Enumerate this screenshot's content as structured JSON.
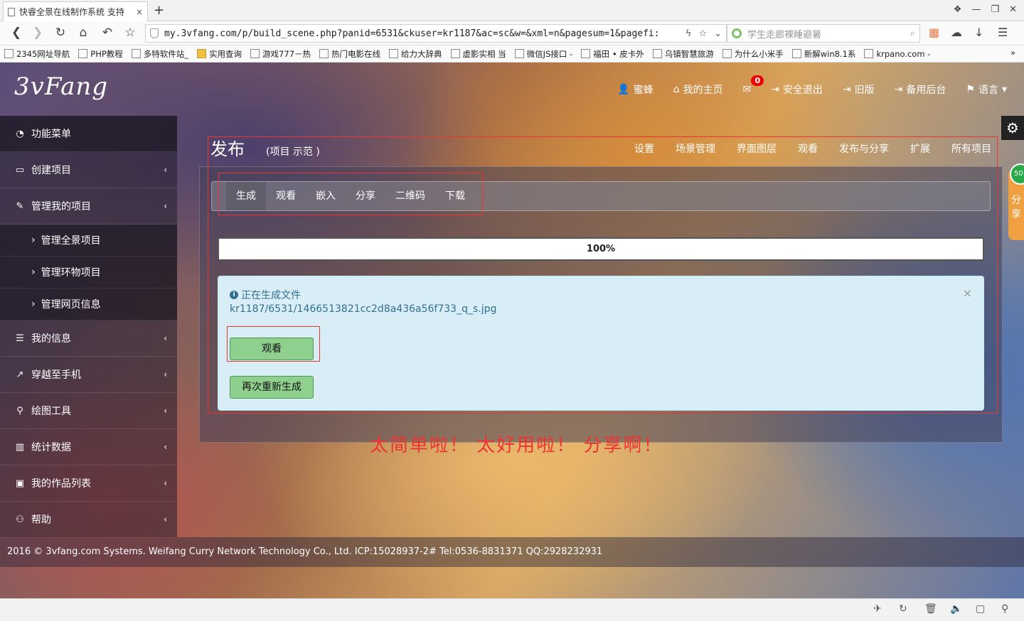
{
  "browser": {
    "tab_title": "快睿全景在线制作系统 支持",
    "tab_close": "×",
    "new_tab": "+",
    "url": "my.3vfang.com/p/build_scene.php?panid=6531&ckuser=kr1187&ac=sc&w=&xml=n&pagesum=1&pagefi:",
    "search_placeholder": "学生走廊裸睡避暑",
    "bookmarks": [
      "2345网址导航",
      "PHP教程",
      "多特软件站_",
      "实用查询",
      "游戏777－热",
      "热门电影在线",
      "给力大辞典",
      "虚影实相 当",
      "微信JS接口 -",
      "福田 • 皮卡外",
      "乌镇智慧旅游",
      "为什么小米手",
      "新解win8.1系",
      "krpano.com -"
    ],
    "bookmarks_more": "»"
  },
  "header": {
    "logo": "3vFang",
    "nav": [
      {
        "label": "蜜蜂",
        "icon": "user-icon"
      },
      {
        "label": "我的主页",
        "icon": "home-icon"
      },
      {
        "label": "",
        "icon": "envelope-icon",
        "badge": "0"
      },
      {
        "label": "安全退出",
        "icon": "logout-icon"
      },
      {
        "label": "旧版",
        "icon": "logout-icon"
      },
      {
        "label": "备用后台",
        "icon": "logout-icon"
      },
      {
        "label": "语言",
        "icon": "flag-icon"
      }
    ]
  },
  "sidebar": {
    "items": [
      {
        "label": "功能菜单",
        "icon": "dashboard-icon"
      },
      {
        "label": "创建项目",
        "icon": "monitor-icon"
      },
      {
        "label": "管理我的项目",
        "icon": "edit-icon"
      },
      {
        "label": "管理全景项目"
      },
      {
        "label": "管理环物项目"
      },
      {
        "label": "管理网页信息"
      },
      {
        "label": "我的信息",
        "icon": "list-icon"
      },
      {
        "label": "穿越至手机",
        "icon": "external-link-icon"
      },
      {
        "label": "绘图工具",
        "icon": "map-marker-icon"
      },
      {
        "label": "统计数据",
        "icon": "bar-chart-icon"
      },
      {
        "label": "我的作品列表",
        "icon": "image-icon"
      },
      {
        "label": "帮助",
        "icon": "sitemap-icon"
      }
    ]
  },
  "page": {
    "title": "发布",
    "subtitle": "(项目 示范 )",
    "nav": [
      "设置",
      "场景管理",
      "界面图层",
      "观看",
      "发布与分享",
      "扩展",
      "所有项目"
    ],
    "subtabs": [
      "生成",
      "观看",
      "嵌入",
      "分享",
      "二维码",
      "下载"
    ],
    "progress_label": "100%",
    "progress": 1.0,
    "alert_title": "正在生成文件",
    "alert_file": "kr1187/6531/1466513821cc2d8a436a56f733_q_s.jpg",
    "alert_close": "×",
    "view_button": "观看",
    "regenerate_button": "再次重新生成",
    "slogan": "太简单啦！ 太好用啦！ 分享啊！"
  },
  "share_widget": {
    "count": "50",
    "label": "分享"
  },
  "footer": {
    "text": "2016 © 3vfang.com Systems. Weifang Curry Network Technology Co., Ltd. ICP:15028937-2# Tel:0536-8831371 QQ:2928232931"
  }
}
